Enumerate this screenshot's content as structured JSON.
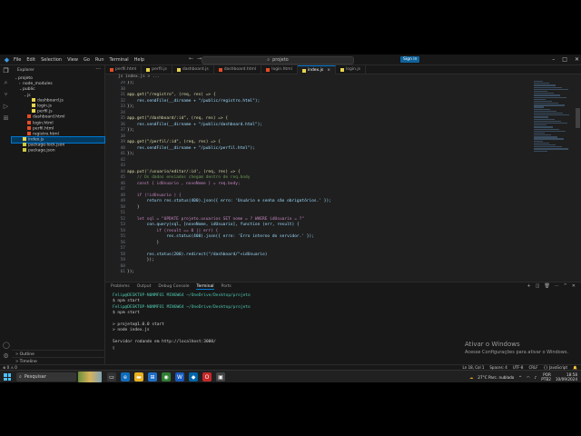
{
  "titlebar": {
    "menu": [
      "File",
      "Edit",
      "Selection",
      "View",
      "Go",
      "Run",
      "Terminal",
      "Help"
    ],
    "search": "projeto",
    "signin": "Sign in"
  },
  "sidebar": {
    "title": "Explorer",
    "items": [
      {
        "label": "projeto",
        "indent": 0,
        "chev": "v",
        "type": "folder"
      },
      {
        "label": "node_modules",
        "indent": 1,
        "chev": ">",
        "type": "folder"
      },
      {
        "label": "public",
        "indent": 1,
        "chev": "v",
        "type": "folder"
      },
      {
        "label": "js",
        "indent": 2,
        "chev": "v",
        "type": "folder"
      },
      {
        "label": "dashboard.js",
        "indent": 3,
        "chev": "",
        "type": "js"
      },
      {
        "label": "login.js",
        "indent": 3,
        "chev": "",
        "type": "js"
      },
      {
        "label": "perfil.js",
        "indent": 3,
        "chev": "",
        "type": "js"
      },
      {
        "label": "dashboard.html",
        "indent": 2,
        "chev": "",
        "type": "html"
      },
      {
        "label": "login.html",
        "indent": 2,
        "chev": "",
        "type": "html"
      },
      {
        "label": "perfil.html",
        "indent": 2,
        "chev": "",
        "type": "html"
      },
      {
        "label": "registro.html",
        "indent": 2,
        "chev": "",
        "type": "html"
      },
      {
        "label": "index.js",
        "indent": 1,
        "chev": "",
        "type": "js",
        "selected": true
      },
      {
        "label": "package-lock.json",
        "indent": 1,
        "chev": "",
        "type": "json"
      },
      {
        "label": "package.json",
        "indent": 1,
        "chev": "",
        "type": "json"
      }
    ],
    "outline": "Outline",
    "timeline": "Timeline"
  },
  "tabs": [
    {
      "label": "perfil.html",
      "type": "html"
    },
    {
      "label": "perfil.js",
      "type": "js"
    },
    {
      "label": "dashboard.js",
      "type": "js"
    },
    {
      "label": "dashboard.html",
      "type": "html"
    },
    {
      "label": "login.html",
      "type": "html"
    },
    {
      "label": "index.js",
      "type": "js",
      "active": true
    },
    {
      "label": "login.js",
      "type": "js"
    }
  ],
  "breadcrumb": "js  index.js > ...",
  "editor": {
    "lines": [
      {
        "n": "29",
        "t": "});"
      },
      {
        "n": "30",
        "t": ""
      },
      {
        "n": "31",
        "t": "app.get(\"/registro\", (req, res) => {"
      },
      {
        "n": "32",
        "t": "    res.sendFile(__dirname + \"/public/registro.html\");"
      },
      {
        "n": "33",
        "t": "});"
      },
      {
        "n": "34",
        "t": ""
      },
      {
        "n": "35",
        "t": "app.get(\"/dashboard/:id\", (req, res) => {"
      },
      {
        "n": "36",
        "t": "    res.sendFile(__dirname + \"/public/dashboard.html\");"
      },
      {
        "n": "37",
        "t": "});"
      },
      {
        "n": "38",
        "t": ""
      },
      {
        "n": "39",
        "t": "app.get(\"/perfil/:id\", (req, res) => {"
      },
      {
        "n": "40",
        "t": "    res.sendFile(__dirname + \"/public/perfil.html\");"
      },
      {
        "n": "41",
        "t": "});"
      },
      {
        "n": "42",
        "t": ""
      },
      {
        "n": "43",
        "t": ""
      },
      {
        "n": "44",
        "t": "app.put('/usuario/editar/:id', (req, res) => {"
      },
      {
        "n": "45",
        "t": "    // Os dados enviados chegam dentro de req.body"
      },
      {
        "n": "46",
        "t": "    const { idUsuario , novoNome } = req.body;"
      },
      {
        "n": "47",
        "t": ""
      },
      {
        "n": "48",
        "t": "    if (!idUsuario ) {"
      },
      {
        "n": "49",
        "t": "        return res.status(400).json({ erro: 'Usuário e senha são obrigatórios.' });"
      },
      {
        "n": "50",
        "t": "    }"
      },
      {
        "n": "51",
        "t": ""
      },
      {
        "n": "52",
        "t": "    let sql = \"UPDATE projeto.usuarios SET nome = ? WHERE idUsuario = ?\""
      },
      {
        "n": "53",
        "t": "        con.query(sql, [novoNome, idUsuario], function (err, result) {"
      },
      {
        "n": "54",
        "t": "            if (result == 0 || err) {"
      },
      {
        "n": "55",
        "t": "                res.status(400).json({ erro: 'Erro interno do servidor.' });"
      },
      {
        "n": "56",
        "t": "            }"
      },
      {
        "n": "57",
        "t": ""
      },
      {
        "n": "58",
        "t": "        res.status(200).redirect(\"/dashboard/\"+idUsuario)"
      },
      {
        "n": "59",
        "t": "        });"
      },
      {
        "n": "60",
        "t": ""
      },
      {
        "n": "61",
        "t": "});"
      }
    ]
  },
  "panel": {
    "tabs": [
      "Problems",
      "Output",
      "Debug Console",
      "Terminal",
      "Ports"
    ],
    "active_tab": "Terminal",
    "lines": [
      "Felip@DESKTOP-N0NMFO1 MINGW64 ~/OneDrive/Desktop/projeto",
      "$ npm start",
      "Felip@DESKTOP-N0NMFO1 MINGW64 ~/OneDrive/Desktop/projeto",
      "$ npm start",
      "",
      "> projeto@1.0.0 start",
      "> node index.js",
      "",
      "Servidor rodando em http://localhost:3000/",
      "▯"
    ]
  },
  "status": {
    "position": "Ln 18, Col 1",
    "spaces": "Spaces: 4",
    "encoding": "UTF-8",
    "eol": "CRLF",
    "language": "{} JavaScript"
  },
  "watermark": {
    "title": "Ativar o Windows",
    "subtitle": "Acesse Configurações para ativar o Windows."
  },
  "taskbar": {
    "search": "Pesquisar",
    "weather": "27°C  Parc. nublado",
    "lang": "POR",
    "lang2": "PTB2",
    "time": "18:58",
    "date": "10/09/2024"
  }
}
